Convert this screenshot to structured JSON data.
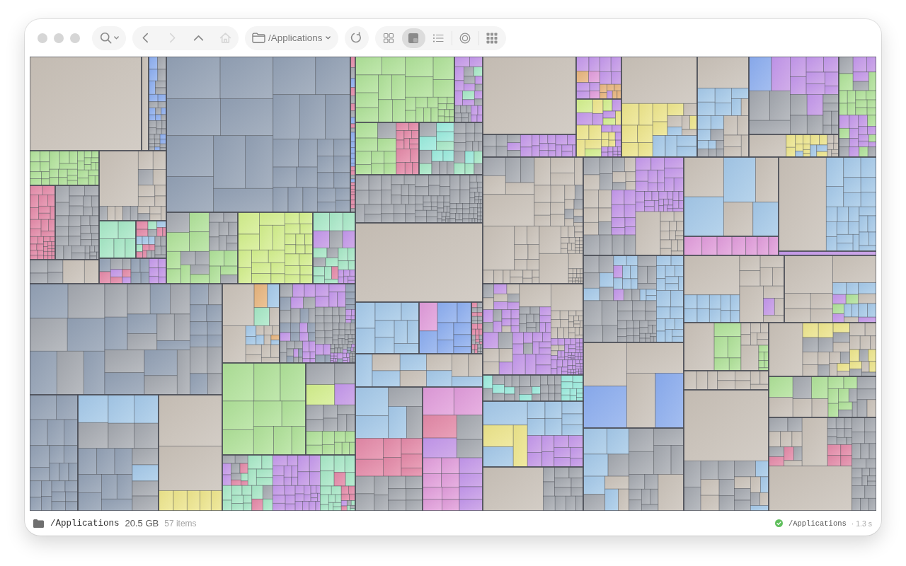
{
  "toolbar": {
    "nav": [
      {
        "kind": "back",
        "disabled": false
      },
      {
        "kind": "forward",
        "disabled": true
      },
      {
        "kind": "up",
        "disabled": false
      },
      {
        "kind": "home",
        "disabled": true
      }
    ],
    "path": "/Applications",
    "views": [
      {
        "kind": "grid",
        "selected": false
      },
      {
        "kind": "treemap",
        "selected": true
      },
      {
        "kind": "list",
        "selected": false
      },
      {
        "kind": "rings",
        "selected": false
      },
      {
        "kind": "tiles",
        "selected": false
      }
    ]
  },
  "status_bar": {
    "path": "/Applications",
    "size": "20.5 GB",
    "count": "57 items",
    "scan": {
      "done": true,
      "path": "/Applications",
      "time": "· 1.3 s"
    }
  }
}
